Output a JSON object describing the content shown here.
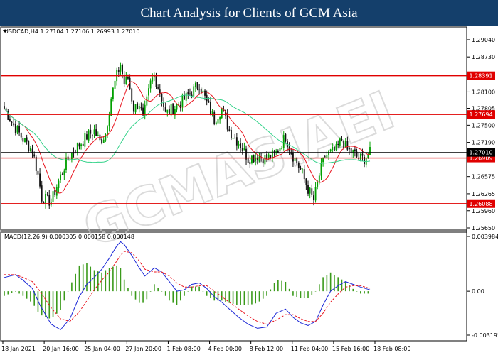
{
  "header": {
    "title": "Chart Analysis for Clients of GCM Asia"
  },
  "colors": {
    "header_bg": "#143f6b",
    "bull": "#00a000",
    "bear": "#111111",
    "ma_fast": "#e8141e",
    "ma_slow": "#34d28a",
    "level_line": "#e00000",
    "price_label_bg": "#e00000",
    "price_label_current": "#000000",
    "macd_hist": "#3a9a1a",
    "macd_main": "#1a26d6",
    "macd_signal": "#e8141e"
  },
  "watermark": {
    "text": "GCMASIAEI"
  },
  "chart_data": [
    {
      "type": "candlestick",
      "title": "USDCAD,H4  1.27104 1.27106 1.26993 1.27010",
      "ylim": [
        1.2565,
        1.2918
      ],
      "y_ticks": [
        "1.29040",
        "1.28730",
        "1.28100",
        "1.27805",
        "1.27500",
        "1.27190",
        "1.26575",
        "1.26265",
        "1.25960",
        "1.25650"
      ],
      "x_ticks": [
        "18 Jan 2021",
        "20 Jan 16:00",
        "25 Jan 04:00",
        "27 Jan 20:00",
        "1 Feb 08:00",
        "4 Feb 00:00",
        "8 Feb 12:00",
        "11 Feb 04:00",
        "15 Feb 16:00",
        "18 Feb 08:00"
      ],
      "levels": [
        {
          "label": "1.28391",
          "value": 1.28391
        },
        {
          "label": "1.27694",
          "value": 1.27694
        },
        {
          "label": "1.26909",
          "value": 1.26909
        },
        {
          "label": "1.26088",
          "value": 1.26088
        }
      ],
      "current_price": {
        "label": "1.27010",
        "value": 1.2701
      },
      "anchors": [
        [
          0,
          1.278
        ],
        [
          5,
          1.275
        ],
        [
          10,
          1.2725
        ],
        [
          15,
          1.2705
        ],
        [
          18,
          1.266
        ],
        [
          20,
          1.262
        ],
        [
          25,
          1.2612
        ],
        [
          28,
          1.264
        ],
        [
          32,
          1.2675
        ],
        [
          36,
          1.27
        ],
        [
          40,
          1.2715
        ],
        [
          44,
          1.273
        ],
        [
          48,
          1.274
        ],
        [
          51,
          1.272
        ],
        [
          54,
          1.2735
        ],
        [
          57,
          1.28
        ],
        [
          60,
          1.284
        ],
        [
          62,
          1.286
        ],
        [
          64,
          1.2825
        ],
        [
          66,
          1.2835
        ],
        [
          69,
          1.278
        ],
        [
          72,
          1.279
        ],
        [
          74,
          1.276
        ],
        [
          78,
          1.2825
        ],
        [
          80,
          1.284
        ],
        [
          84,
          1.28
        ],
        [
          86,
          1.277
        ],
        [
          90,
          1.278
        ],
        [
          94,
          1.279
        ],
        [
          97,
          1.28
        ],
        [
          100,
          1.281
        ],
        [
          104,
          1.2825
        ],
        [
          108,
          1.279
        ],
        [
          112,
          1.276
        ],
        [
          116,
          1.278
        ],
        [
          120,
          1.274
        ],
        [
          126,
          1.2715
        ],
        [
          130,
          1.269
        ],
        [
          135,
          1.2695
        ],
        [
          140,
          1.269
        ],
        [
          145,
          1.27
        ],
        [
          150,
          1.273
        ],
        [
          152,
          1.271
        ],
        [
          154,
          1.2695
        ],
        [
          158,
          1.267
        ],
        [
          162,
          1.2635
        ],
        [
          165,
          1.2615
        ],
        [
          168,
          1.266
        ],
        [
          171,
          1.2695
        ],
        [
          174,
          1.27
        ],
        [
          177,
          1.2705
        ],
        [
          180,
          1.2725
        ],
        [
          183,
          1.2705
        ],
        [
          186,
          1.27
        ],
        [
          189,
          1.269
        ],
        [
          192,
          1.269
        ],
        [
          195,
          1.27
        ]
      ]
    },
    {
      "type": "line",
      "title": "MACD(12,26,9) 0.000305 0.000158 0.000148",
      "ylim": [
        -0.003195,
        0.003984
      ],
      "y_ticks": [
        "0.003984",
        "0.00",
        "-0.003195"
      ],
      "series": [
        {
          "role": "main",
          "x": [
            0,
            6,
            10,
            15,
            19,
            25,
            30,
            35,
            40,
            44,
            48,
            52,
            56,
            60,
            62,
            64,
            68,
            72,
            75,
            80,
            84,
            88,
            92,
            96,
            100,
            104,
            108,
            112,
            116,
            120,
            125,
            130,
            135,
            140,
            145,
            150,
            154,
            158,
            162,
            166,
            170,
            174,
            178,
            182,
            186,
            190,
            195
          ],
          "values": [
            0.001,
            0.0012,
            0.0008,
            0.0002,
            -0.001,
            -0.0024,
            -0.0028,
            -0.002,
            -0.0004,
            0.0005,
            0.001,
            0.0016,
            0.0024,
            0.0033,
            0.0036,
            0.0034,
            0.0026,
            0.0017,
            0.0011,
            0.0017,
            0.0014,
            0.0007,
            0.0,
            0.0001,
            0.0005,
            0.0006,
            0.0002,
            -0.0004,
            -0.0008,
            -0.0013,
            -0.0019,
            -0.0024,
            -0.0027,
            -0.0026,
            -0.0016,
            -0.0013,
            -0.0019,
            -0.0023,
            -0.0025,
            -0.0022,
            -0.001,
            0.0,
            0.0004,
            0.0007,
            0.0005,
            0.0003,
            0.0001
          ]
        },
        {
          "role": "signal",
          "x": [
            0,
            6,
            10,
            15,
            19,
            25,
            30,
            35,
            40,
            44,
            48,
            52,
            56,
            60,
            62,
            64,
            68,
            72,
            75,
            80,
            84,
            88,
            92,
            96,
            100,
            104,
            108,
            112,
            116,
            120,
            125,
            130,
            135,
            140,
            145,
            150,
            154,
            158,
            162,
            166,
            170,
            174,
            178,
            182,
            186,
            190,
            195
          ],
          "values": [
            0.0012,
            0.0012,
            0.001,
            0.0007,
            0.0,
            -0.0012,
            -0.002,
            -0.0022,
            -0.0015,
            -0.0007,
            0.0001,
            0.0008,
            0.0014,
            0.0022,
            0.0026,
            0.0029,
            0.0028,
            0.0022,
            0.0016,
            0.0014,
            0.0014,
            0.0011,
            0.0006,
            0.0003,
            0.0003,
            0.0004,
            0.0004,
            0.0,
            -0.0004,
            -0.0008,
            -0.0013,
            -0.0018,
            -0.0022,
            -0.0024,
            -0.0021,
            -0.0017,
            -0.0017,
            -0.002,
            -0.0022,
            -0.0022,
            -0.0016,
            -0.0008,
            -0.0002,
            0.0003,
            0.0004,
            0.0004,
            0.0002
          ]
        }
      ]
    }
  ]
}
